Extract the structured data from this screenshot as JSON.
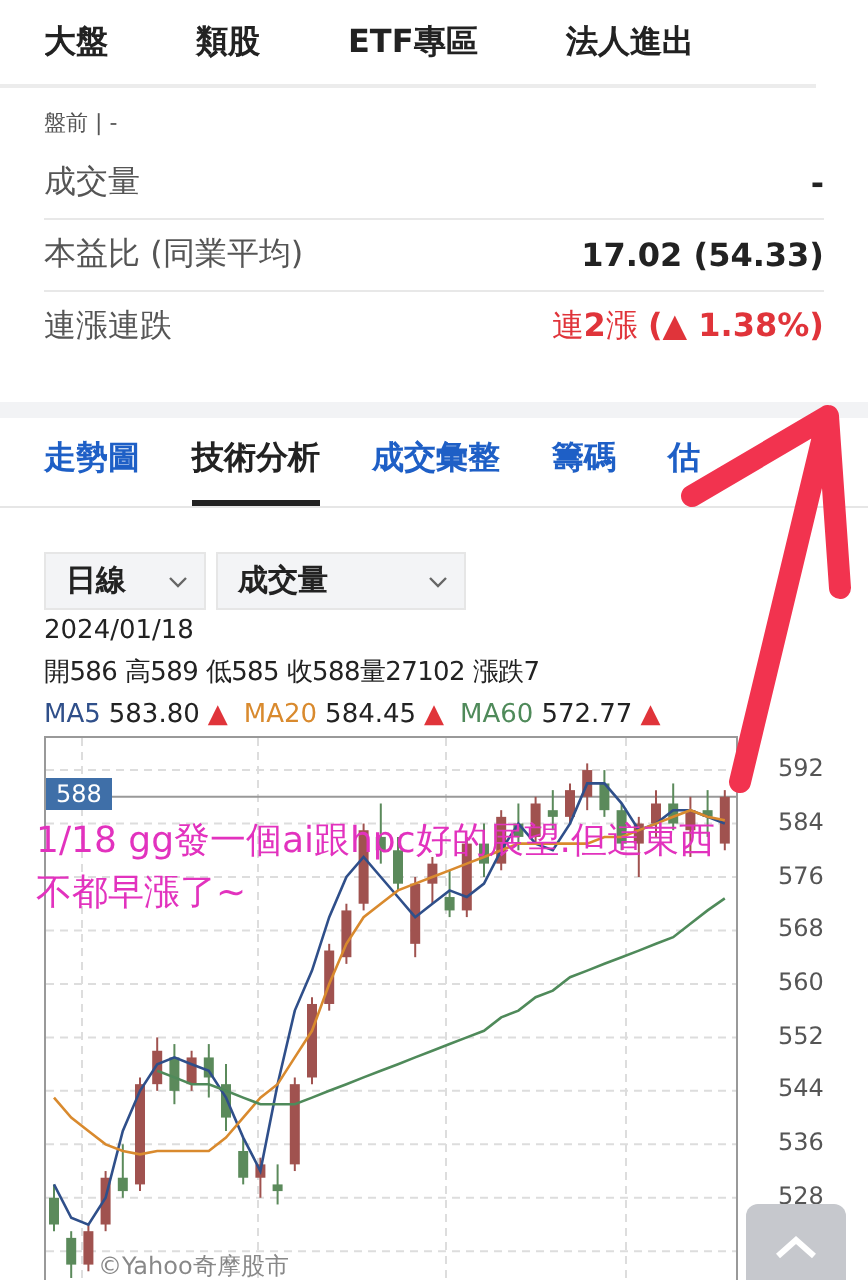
{
  "top_tabs": [
    {
      "label": "大盤"
    },
    {
      "label": "類股"
    },
    {
      "label": "ETF專區"
    },
    {
      "label": "法人進出"
    }
  ],
  "session": "盤前 | -",
  "stats": [
    {
      "label": "成交量",
      "value": "-",
      "kind": "plain"
    },
    {
      "label": "本益比 (同業平均)",
      "value": "17.02 (54.33)",
      "kind": "plain"
    },
    {
      "label": "連漲連跌",
      "value": "連**2**漲 **(▲ 1.38%)**",
      "kind": "up"
    }
  ],
  "sub_tabs": [
    {
      "label": "走勢圖",
      "selected": false
    },
    {
      "label": "技術分析",
      "selected": true
    },
    {
      "label": "成交彙整",
      "selected": false
    },
    {
      "label": "籌碼",
      "selected": false
    },
    {
      "label": "估",
      "selected": false
    }
  ],
  "selects": [
    "日線",
    "成交量"
  ],
  "date": "2024/01/18",
  "ohlc": "開586 高589 低585 收588量27102 漲跌7",
  "ma": [
    {
      "value": "583.80",
      "mark": "▲",
      "kind": "up"
    },
    {
      "value": "584.45",
      "mark": "▲",
      "kind": "up"
    },
    {
      "value": "572.77",
      "mark": "▲",
      "kind": "up"
    }
  ],
  "chart": {
    "credit": "©Yahoo奇摩股市",
    "chart_data": {
      "type": "candlestick",
      "ylim": [
        514.5,
        596.8
      ],
      "yticks": [
        592,
        584,
        576,
        568,
        560,
        552,
        544,
        536,
        528
      ],
      "grid": true,
      "ref_lines": [
        {
          "axis": "y",
          "value": 588,
          "label": "588"
        }
      ],
      "ohlc": [
        [
          528,
          530,
          523,
          524
        ],
        [
          522,
          523,
          516,
          518
        ],
        [
          518,
          524,
          517,
          523
        ],
        [
          524,
          532,
          523,
          531
        ],
        [
          531,
          536,
          528,
          529
        ],
        [
          530,
          546,
          529,
          545
        ],
        [
          545,
          552,
          544,
          550
        ],
        [
          549,
          551,
          542,
          544
        ],
        [
          545,
          550,
          544,
          549
        ],
        [
          549,
          551,
          543,
          546
        ],
        [
          545,
          548,
          538,
          540
        ],
        [
          535,
          537,
          530,
          531
        ],
        [
          531,
          534,
          528,
          533
        ],
        [
          530,
          533,
          527,
          529
        ],
        [
          533,
          546,
          532,
          545
        ],
        [
          546,
          558,
          545,
          557
        ],
        [
          557,
          566,
          556,
          565
        ],
        [
          564,
          572,
          563,
          571
        ],
        [
          572,
          584,
          571,
          583
        ],
        [
          582,
          587,
          578,
          580
        ],
        [
          580,
          582,
          574,
          575
        ],
        [
          566,
          576,
          564,
          575
        ],
        [
          575,
          579,
          572,
          578
        ],
        [
          573,
          577,
          570,
          571
        ],
        [
          571,
          582,
          570,
          581
        ],
        [
          581,
          584,
          576,
          578
        ],
        [
          578,
          586,
          577,
          585
        ],
        [
          584,
          587,
          580,
          582
        ],
        [
          582,
          588,
          581,
          587
        ],
        [
          586,
          589,
          583,
          585
        ],
        [
          585,
          590,
          584,
          589
        ],
        [
          588,
          593,
          586,
          592
        ],
        [
          590,
          592,
          585,
          586
        ],
        [
          586,
          587,
          580,
          581
        ],
        [
          581,
          585,
          576,
          584
        ],
        [
          584,
          589,
          582,
          587
        ],
        [
          587,
          590,
          583,
          584
        ],
        [
          583,
          588,
          579,
          586
        ],
        [
          586,
          589,
          582,
          585
        ],
        [
          581,
          589,
          580,
          588
        ]
      ],
      "series": [
        {
          "name": "MA5",
          "type": "line",
          "color": "#2f4f8a",
          "values": [
            530,
            525,
            524,
            528,
            538,
            544,
            548,
            549,
            548,
            547,
            543,
            537,
            532,
            545,
            556,
            562,
            570,
            576,
            579,
            576,
            573,
            570,
            572,
            574,
            573,
            575,
            580,
            584,
            581,
            580,
            584,
            590,
            590,
            587,
            583,
            584,
            586,
            586,
            585,
            584
          ]
        },
        {
          "name": "MA20",
          "type": "line",
          "color": "#d98a2e",
          "values": [
            543,
            540,
            538,
            536,
            535,
            534.5,
            535,
            535,
            535,
            535,
            537,
            540,
            543,
            545,
            549,
            553,
            560,
            566,
            570,
            572,
            574,
            575,
            576,
            577,
            578,
            579,
            580,
            581,
            581,
            581,
            581,
            581,
            582,
            582,
            583,
            584,
            585,
            586,
            585,
            584.5
          ]
        },
        {
          "name": "MA60",
          "type": "line",
          "color": "#4f8a5a",
          "values": [
            null,
            null,
            null,
            null,
            null,
            null,
            547,
            546,
            545,
            545,
            544,
            543,
            542,
            542,
            542,
            543,
            544,
            545,
            546,
            547,
            548,
            549,
            550,
            551,
            552,
            553,
            555,
            556,
            558,
            559,
            561,
            562,
            563,
            564,
            565,
            566,
            567,
            569,
            571,
            572.8
          ]
        }
      ]
    }
  },
  "annotation": {
    "text": "1/18  gg發一個ai跟hpc好的展望.但這東西不都早漲了~"
  }
}
